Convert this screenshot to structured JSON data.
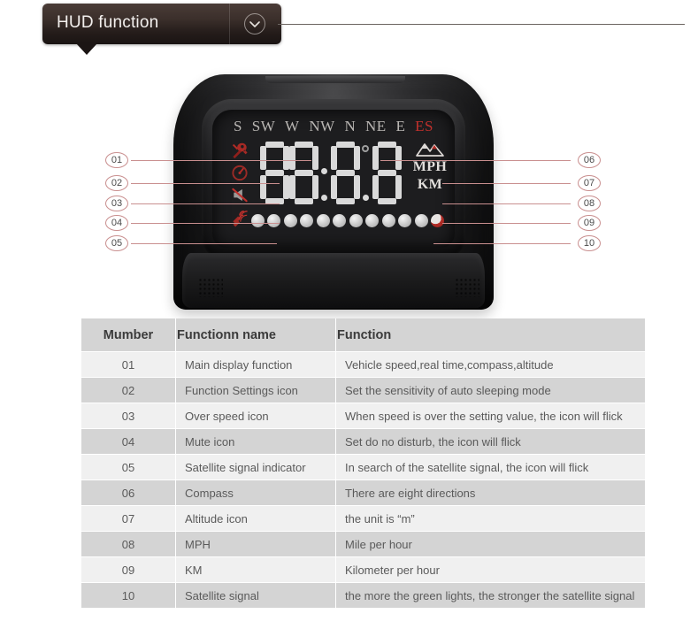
{
  "banner": {
    "title": "HUD function",
    "toggle_icon": "chevron-down-icon"
  },
  "device": {
    "compass_directions": [
      {
        "label": "S",
        "active": false
      },
      {
        "label": "SW",
        "active": false
      },
      {
        "label": "W",
        "active": false
      },
      {
        "label": "NW",
        "active": false
      },
      {
        "label": "N",
        "active": false
      },
      {
        "label": "NE",
        "active": false
      },
      {
        "label": "E",
        "active": false
      },
      {
        "label": "ES",
        "active": true
      }
    ],
    "left_icons": [
      {
        "name": "wrench-settings-icon",
        "label": "Function Settings icon"
      },
      {
        "name": "over-speed-icon",
        "label": "Over speed icon"
      },
      {
        "name": "mute-icon",
        "label": "Mute icon"
      },
      {
        "name": "satellite-signal-icon",
        "label": "Satellite signal indicator"
      }
    ],
    "digits": "88:8.8",
    "right_units": [
      {
        "name": "altitude-mountain-icon",
        "label": "Altitude icon"
      },
      {
        "name": "mph-label",
        "label": "MPH"
      },
      {
        "name": "km-label",
        "label": "KM"
      }
    ],
    "satellite_dots_total": 12,
    "satellite_dots_active": 11
  },
  "callouts": {
    "left": [
      "01",
      "02",
      "03",
      "04",
      "05"
    ],
    "right": [
      "06",
      "07",
      "08",
      "09",
      "10"
    ]
  },
  "table": {
    "headers": [
      "Mumber",
      "Functionn name",
      "Function"
    ],
    "rows": [
      {
        "number": "01",
        "name": "Main display function",
        "function": "Vehicle speed,real time,compass,altitude"
      },
      {
        "number": "02",
        "name": "Function Settings icon",
        "function": "Set the sensitivity of auto sleeping mode"
      },
      {
        "number": "03",
        "name": "Over speed icon",
        "function": " When speed is over the setting value, the icon will flick"
      },
      {
        "number": "04",
        "name": "Mute icon",
        "function": "Set do no disturb, the icon will flick"
      },
      {
        "number": "05",
        "name": "Satellite signal indicator",
        "function": "In search of the satellite signal, the icon will flick"
      },
      {
        "number": "06",
        "name": "Compass",
        "function": "There are eight directions"
      },
      {
        "number": "07",
        "name": "Altitude icon",
        "function": "the unit is  “m”"
      },
      {
        "number": "08",
        "name": "MPH",
        "function": "Mile per hour"
      },
      {
        "number": "09",
        "name": "KM",
        "function": "Kilometer per hour"
      },
      {
        "number": "10",
        "name": "Satellite signal",
        "function": "the more the green lights, the stronger the satellite signal"
      }
    ]
  },
  "colors": {
    "banner_dark": "#241c1a",
    "accent_red": "#c0302c",
    "callout_line": "#c98f8f",
    "table_header_bg": "#d4d4d4",
    "table_row_light": "#f0f0f0",
    "table_row_dark": "#d4d4d4"
  }
}
